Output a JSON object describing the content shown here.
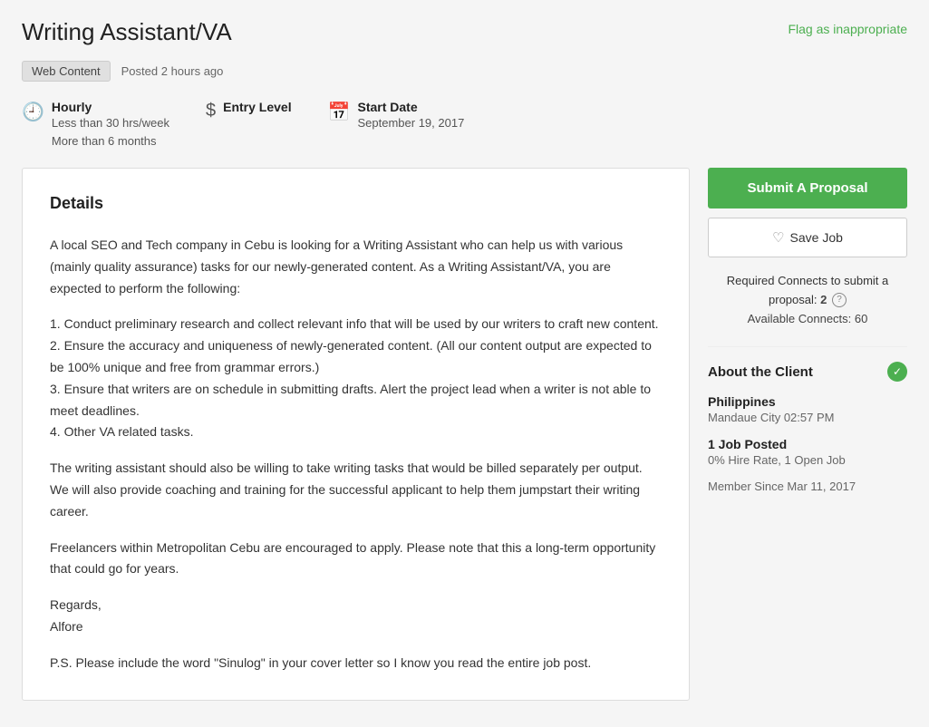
{
  "page": {
    "title": "Writing Assistant/VA",
    "flag_label": "Flag as inappropriate",
    "tag": "Web Content",
    "posted": "Posted 2 hours ago"
  },
  "job_meta": {
    "type_label": "Hourly",
    "type_sub1": "Less than 30 hrs/week",
    "type_sub2": "More than 6 months",
    "level_label": "Entry Level",
    "startdate_label": "Start Date",
    "startdate_value": "September 19, 2017"
  },
  "details": {
    "heading": "Details",
    "paragraphs": [
      "A local SEO and Tech company in Cebu is looking for a Writing Assistant who can help us with various (mainly quality assurance) tasks for our newly-generated content. As a Writing Assistant/VA, you are expected to perform the following:",
      "1. Conduct preliminary research and collect relevant info that will be used by our writers to craft new content.\n2. Ensure the accuracy and uniqueness of newly-generated content. (All our content output are expected to be 100% unique and free from grammar errors.)\n3. Ensure that writers are on schedule in submitting drafts. Alert the project lead when a writer is not able to meet deadlines.\n4. Other VA related tasks.",
      "The writing assistant should also be willing to take writing tasks that would be billed separately per output. We will also provide coaching and training for the successful applicant to help them jumpstart their writing career.",
      "Freelancers within Metropolitan Cebu are encouraged to apply. Please note that this a long-term opportunity that could go for years.",
      "Regards,\nAlfore",
      "P.S. Please include the word \"Sinulog\" in your cover letter so I know you read the entire job post."
    ]
  },
  "sidebar": {
    "submit_label": "Submit A Proposal",
    "save_label": "Save Job",
    "connects_text": "Required Connects to submit a proposal:",
    "connects_count": "2",
    "available_label": "Available Connects:",
    "available_count": "60",
    "client_section_title": "About the Client",
    "client_country": "Philippines",
    "client_city_time": "Mandaue City 02:57 PM",
    "jobs_posted_label": "1 Job Posted",
    "jobs_posted_sub": "0% Hire Rate, 1 Open Job",
    "member_since": "Member Since Mar 11, 2017"
  }
}
